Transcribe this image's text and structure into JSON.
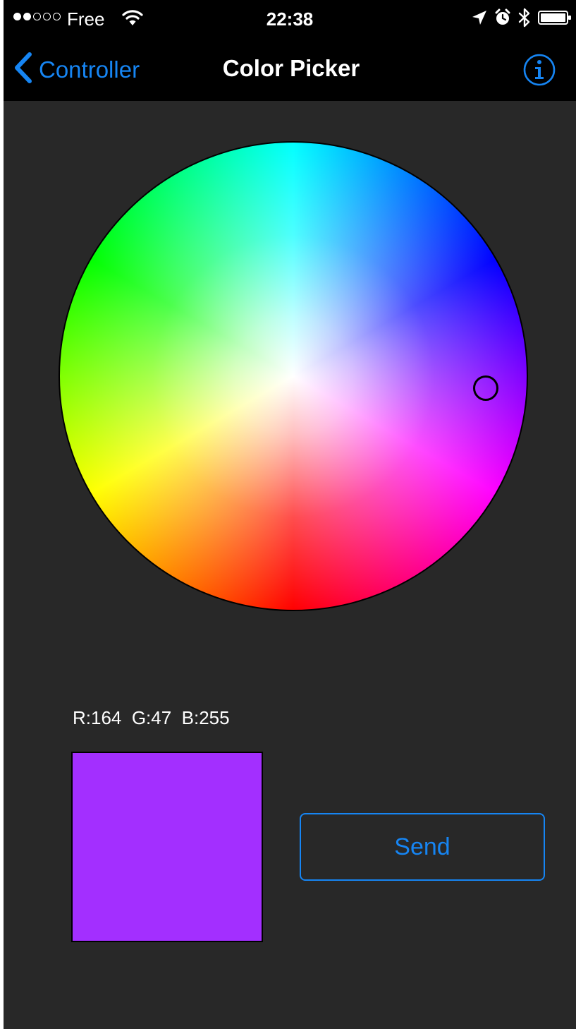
{
  "status_bar": {
    "signal_filled": 2,
    "signal_total": 5,
    "carrier": "Free",
    "time": "22:38",
    "icons": [
      "wifi-icon",
      "location-arrow-icon",
      "alarm-icon",
      "bluetooth-icon",
      "battery-icon"
    ]
  },
  "nav": {
    "back_label": "Controller",
    "title": "Color Picker",
    "back_icon": "chevron-left-icon",
    "info_icon": "info-icon"
  },
  "picker": {
    "readout": "R:164  G:47  B:255",
    "selected_color": "#a32fff",
    "send_label": "Send"
  },
  "colors": {
    "accent": "#1685f3",
    "background": "#282828",
    "bar": "#000000"
  }
}
